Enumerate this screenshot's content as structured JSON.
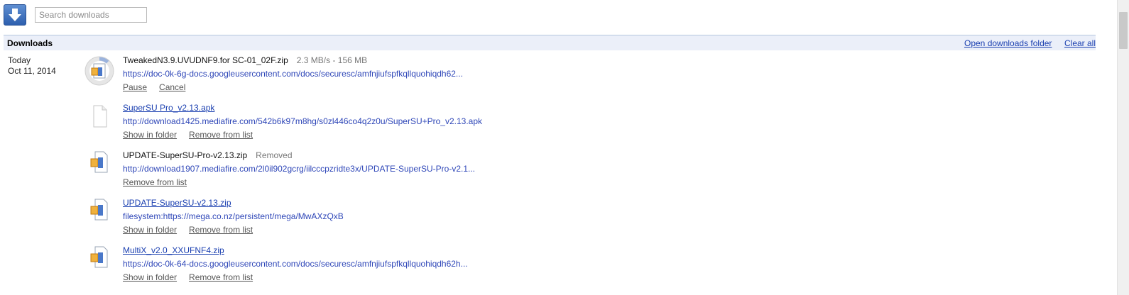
{
  "toolbar": {
    "logo_icon": "download-arrow-icon",
    "search_placeholder": "Search downloads"
  },
  "header": {
    "title": "Downloads",
    "open_folder": "Open downloads folder",
    "clear_all": "Clear all"
  },
  "date_group": {
    "label": "Today",
    "date": "Oct 11, 2014"
  },
  "downloads": [
    {
      "name": "TweakedN3.9.UVUDNF9.for SC-01_02F.zip",
      "status": "2.3 MB/s - 156 MB",
      "progress": 0.12,
      "url": "https://doc-0k-6g-docs.googleusercontent.com/docs/securesc/amfnjiufspfkqllquohiqdh62...",
      "actions": [
        "Pause",
        "Cancel"
      ],
      "icon": "zip-file-icon"
    },
    {
      "name": "SuperSU Pro_v2.13.apk",
      "status": "",
      "url": "http://download1425.mediafire.com/542b6k97m8hg/s0zl446co4q2z0u/SuperSU+Pro_v2.13.apk",
      "actions": [
        "Show in folder",
        "Remove from list"
      ],
      "icon": "blank-file-icon"
    },
    {
      "name": "UPDATE-SuperSU-Pro-v2.13.zip",
      "status": "Removed",
      "url": "http://download1907.mediafire.com/2l0il902gcrg/iilcccpzridte3x/UPDATE-SuperSU-Pro-v2.1...",
      "actions": [
        "Remove from list"
      ],
      "icon": "zip-file-icon"
    },
    {
      "name": "UPDATE-SuperSU-v2.13.zip",
      "status": "",
      "url": "filesystem:https://mega.co.nz/persistent/mega/MwAXzQxB",
      "actions": [
        "Show in folder",
        "Remove from list"
      ],
      "icon": "zip-file-icon"
    },
    {
      "name": "MultiX_v2.0_XXUFNF4.zip",
      "status": "",
      "url": "https://doc-0k-64-docs.googleusercontent.com/docs/securesc/amfnjiufspfkqllquohiqdh62h...",
      "actions": [
        "Show in folder",
        "Remove from list"
      ],
      "icon": "zip-file-icon"
    }
  ]
}
